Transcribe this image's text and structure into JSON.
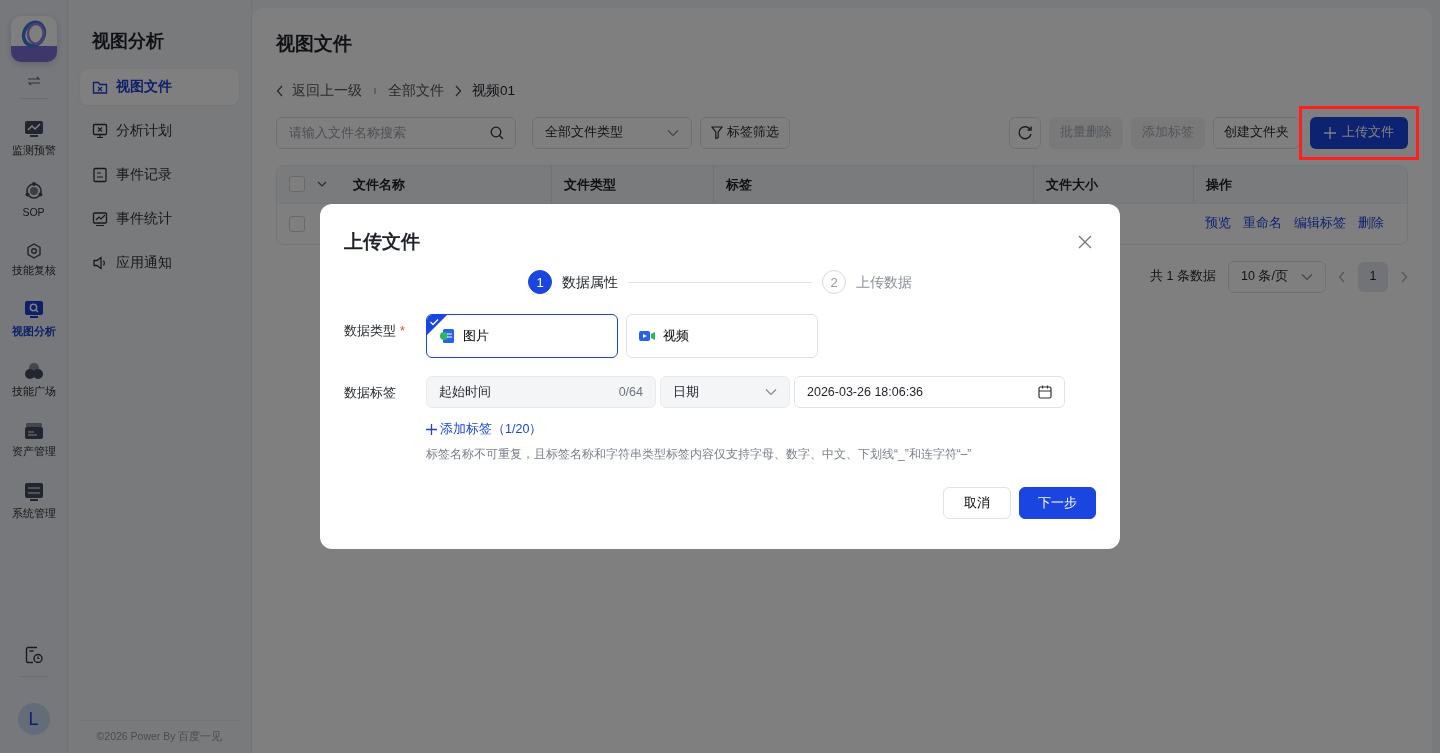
{
  "rail": {
    "items": [
      {
        "label": "监测预警",
        "kind": "monitor",
        "selected": false
      },
      {
        "label": "SOP",
        "kind": "sop",
        "selected": false
      },
      {
        "label": "技能复核",
        "kind": "gear",
        "selected": false
      },
      {
        "label": "视图分析",
        "kind": "search",
        "selected": true
      },
      {
        "label": "技能广场",
        "kind": "circles",
        "selected": false
      },
      {
        "label": "资产管理",
        "kind": "box",
        "selected": false
      },
      {
        "label": "系统管理",
        "kind": "sliders",
        "selected": false
      }
    ],
    "avatar": "L"
  },
  "nav": {
    "title": "视图分析",
    "items": [
      {
        "label": "视图文件",
        "kind": "folder",
        "selected": true
      },
      {
        "label": "分析计划",
        "kind": "screen",
        "selected": false
      },
      {
        "label": "事件记录",
        "kind": "doc",
        "selected": false
      },
      {
        "label": "事件统计",
        "kind": "chart",
        "selected": false
      },
      {
        "label": "应用通知",
        "kind": "speaker",
        "selected": false
      }
    ],
    "footer": "©2026 Power By 百度一见"
  },
  "page": {
    "title": "视图文件",
    "breadcrumb": {
      "back": "返回上一级",
      "items": [
        "全部文件",
        "视频01"
      ]
    },
    "search": {
      "placeholder": "请输入文件名称搜索"
    },
    "type_filter": "全部文件类型",
    "tag_filter": "标签筛选",
    "actions": [
      {
        "label": "批量删除",
        "disabled": true
      },
      {
        "label": "添加标签",
        "disabled": true
      },
      {
        "label": "创建文件夹",
        "disabled": false
      }
    ],
    "upload": "上传文件",
    "table": {
      "select_all_checked": false,
      "columns": [
        "文件名称",
        "文件类型",
        "标签",
        "文件大小",
        "操作"
      ],
      "rows": [
        {
          "checked": false,
          "actions": [
            "预览",
            "重命名",
            "编辑标签",
            "删除"
          ]
        }
      ]
    },
    "pagination": {
      "total": "共 1 条数据",
      "page_size": "10 条/页",
      "pages": [
        {
          "label": "1",
          "selected": true
        }
      ]
    }
  },
  "dialog": {
    "title": "上传文件",
    "steps": [
      {
        "number": "1",
        "label": "数据属性",
        "active": true
      },
      {
        "number": "2",
        "label": "上传数据",
        "active": false
      }
    ],
    "type_label": "数据类型",
    "required_mark": "*",
    "type_options": [
      {
        "label": "图片",
        "kind": "image",
        "selected": true
      },
      {
        "label": "视频",
        "kind": "video",
        "selected": false
      }
    ],
    "tag_label": "数据标签",
    "tags": [
      {
        "name": "起始时间",
        "count": "0/64",
        "type": "日期",
        "value": "2026-03-26 18:06:36"
      }
    ],
    "add_tag": "添加标签（1/20）",
    "hint": "标签名称不可重复，且标签名称和字符串类型标签内容仅支持字母、数字、中文、下划线“_”和连字符“–”",
    "buttons": [
      {
        "label": "取消",
        "kind": "secondary"
      },
      {
        "label": "下一步",
        "kind": "primary"
      }
    ]
  }
}
